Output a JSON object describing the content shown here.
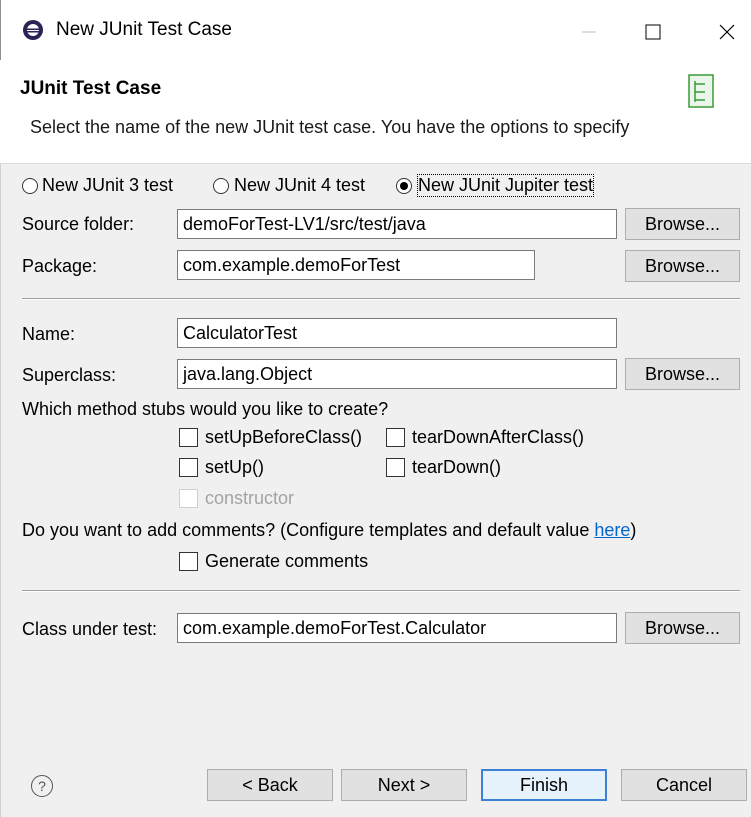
{
  "window": {
    "title": "New JUnit Test Case"
  },
  "header": {
    "title": "JUnit Test Case",
    "description": "Select the name of the new JUnit test case. You have the options to specify"
  },
  "test_type": {
    "options": [
      {
        "label": "New JUnit 3 test",
        "selected": false
      },
      {
        "label": "New JUnit 4 test",
        "selected": false
      },
      {
        "label": "New JUnit Jupiter test",
        "selected": true
      }
    ]
  },
  "source_folder": {
    "label": "Source folder:",
    "value": "demoForTest-LV1/src/test/java",
    "browse": "Browse..."
  },
  "package": {
    "label": "Package:",
    "value": "com.example.demoForTest",
    "browse": "Browse..."
  },
  "name": {
    "label": "Name:",
    "value": "CalculatorTest"
  },
  "superclass": {
    "label": "Superclass:",
    "value": "java.lang.Object",
    "browse": "Browse..."
  },
  "method_stubs": {
    "question": "Which method stubs would you like to create?",
    "setup_before_class": "setUpBeforeClass()",
    "teardown_after_class": "tearDownAfterClass()",
    "setup": "setUp()",
    "teardown": "tearDown()",
    "constructor": "constructor"
  },
  "comments": {
    "question": "Do you want to add comments? (Configure templates and default value",
    "link": "here",
    "question_end": ")",
    "generate": "Generate comments"
  },
  "class_under_test": {
    "label": "Class under test:",
    "value": "com.example.demoForTest.Calculator",
    "browse": "Browse..."
  },
  "footer": {
    "back": "< Back",
    "next": "Next >",
    "finish": "Finish",
    "cancel": "Cancel",
    "help": "?"
  },
  "colors": {
    "accent": "#3c7fd4",
    "link": "#0066cc",
    "body_bg": "#f0f0f0"
  },
  "icons": [
    "eclipse-icon",
    "minimize-icon",
    "maximize-icon",
    "close-icon",
    "wizard-banner-icon",
    "help-icon"
  ]
}
